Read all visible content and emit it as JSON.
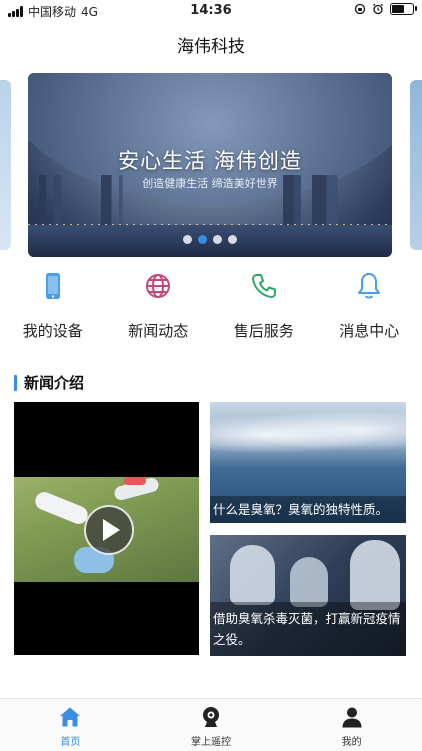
{
  "status_bar": {
    "carrier": "中国移动",
    "network": "4G",
    "time": "14:36",
    "battery_level": 0.65
  },
  "header": {
    "title": "海伟科技"
  },
  "banner": {
    "title": "安心生活 海伟创造",
    "subtitle": "创造健康生活 缔造美好世界",
    "active_slide": 1,
    "slide_count": 4
  },
  "quick_menu": [
    {
      "label": "我的设备",
      "icon": "phone-device-icon",
      "color": "#4a9ee6"
    },
    {
      "label": "新闻动态",
      "icon": "globe-icon",
      "color": "#c2487a"
    },
    {
      "label": "售后服务",
      "icon": "phone-call-icon",
      "color": "#2fa86a"
    },
    {
      "label": "消息中心",
      "icon": "bell-icon",
      "color": "#4a9ee6"
    }
  ],
  "news_section": {
    "title": "新闻介绍",
    "video": {
      "icon": "play-icon"
    },
    "articles": [
      {
        "caption": "什么是臭氧？臭氧的独特性质。"
      },
      {
        "caption": "借助臭氧杀毒灭菌，打赢新冠疫情之役。"
      }
    ]
  },
  "tab_bar": {
    "active_index": 0,
    "accent_color": "#3a8de0",
    "tabs": [
      {
        "label": "首页",
        "icon": "home-icon"
      },
      {
        "label": "掌上遥控",
        "icon": "remote-camera-icon"
      },
      {
        "label": "我的",
        "icon": "user-icon"
      }
    ]
  }
}
